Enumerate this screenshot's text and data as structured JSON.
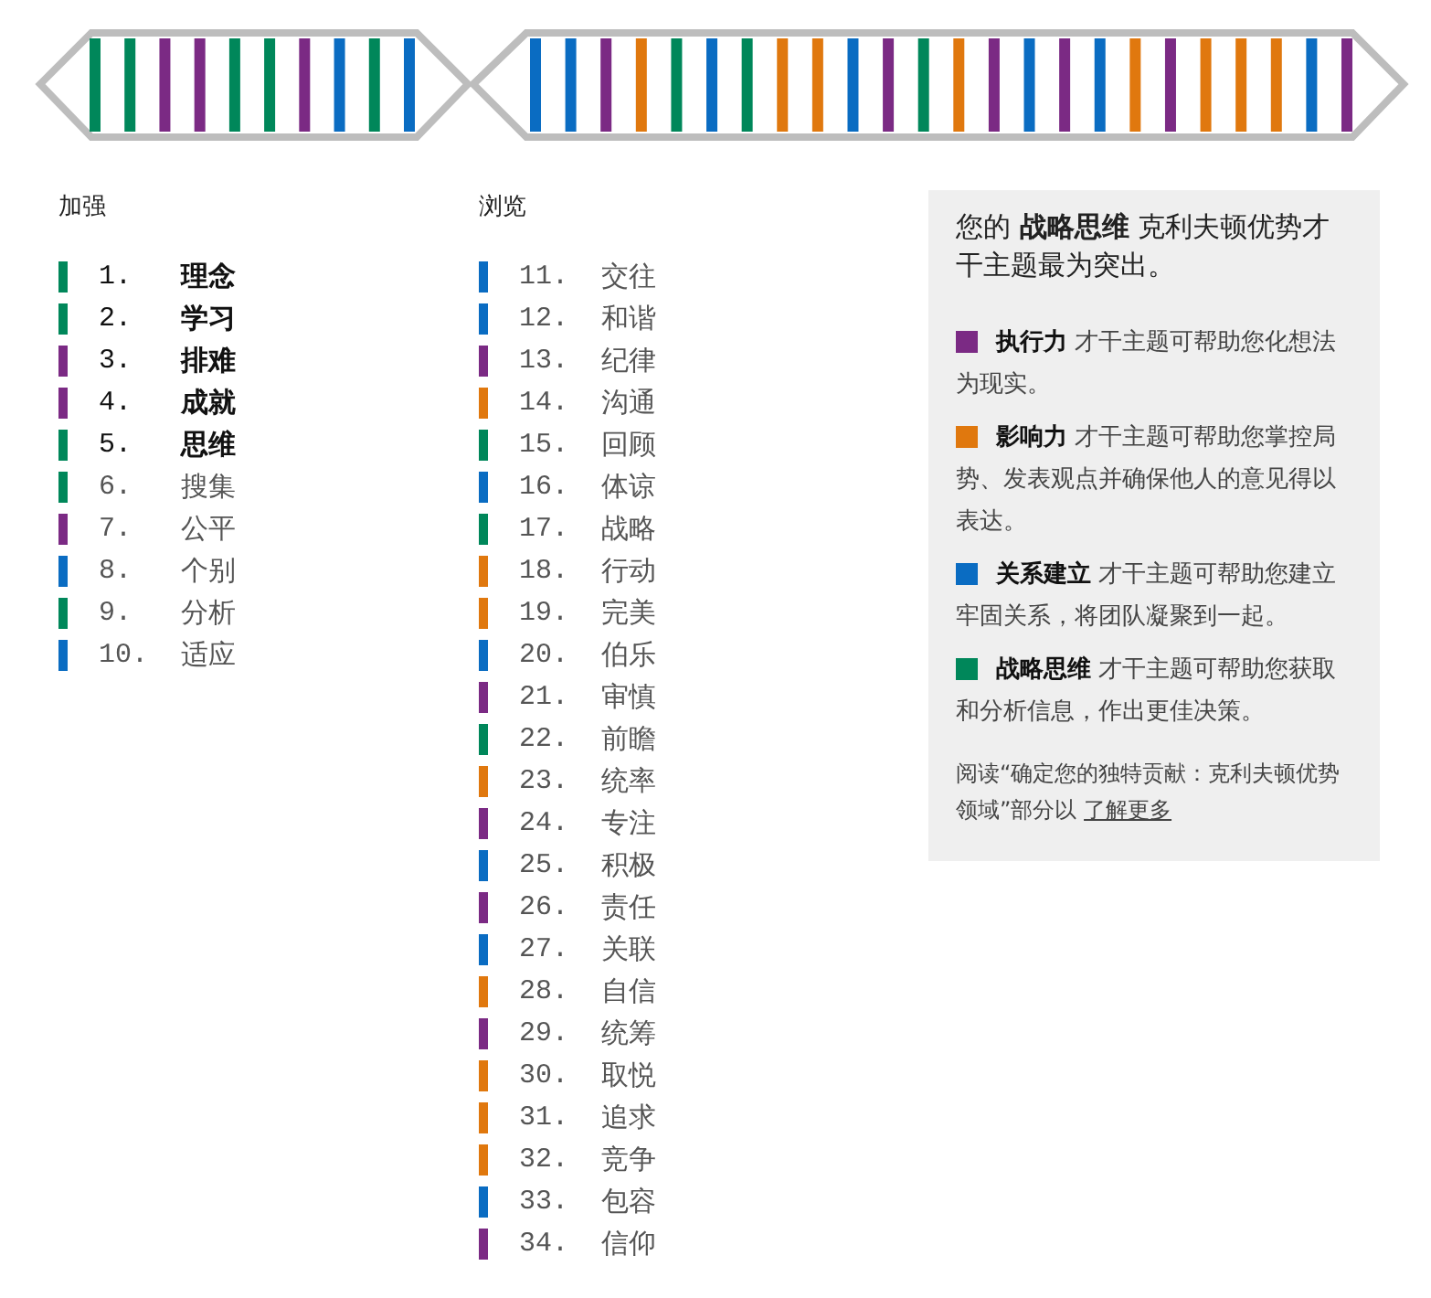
{
  "columns": [
    {
      "heading": "加强",
      "items": [
        {
          "number": "1.",
          "name": "理念",
          "color": "#00875a",
          "bold": true
        },
        {
          "number": "2.",
          "name": "学习",
          "color": "#00875a",
          "bold": true
        },
        {
          "number": "3.",
          "name": "排难",
          "color": "#7b2a84",
          "bold": true
        },
        {
          "number": "4.",
          "name": "成就",
          "color": "#7b2a84",
          "bold": true
        },
        {
          "number": "5.",
          "name": "思维",
          "color": "#00875a",
          "bold": true
        },
        {
          "number": "6.",
          "name": "搜集",
          "color": "#00875a",
          "bold": false
        },
        {
          "number": "7.",
          "name": "公平",
          "color": "#7b2a84",
          "bold": false
        },
        {
          "number": "8.",
          "name": "个别",
          "color": "#0a6cc2",
          "bold": false
        },
        {
          "number": "9.",
          "name": "分析",
          "color": "#00875a",
          "bold": false
        },
        {
          "number": "10.",
          "name": "适应",
          "color": "#0a6cc2",
          "bold": false
        }
      ]
    },
    {
      "heading": "浏览",
      "items": [
        {
          "number": "11.",
          "name": "交往",
          "color": "#0a6cc2",
          "bold": false
        },
        {
          "number": "12.",
          "name": "和谐",
          "color": "#0a6cc2",
          "bold": false
        },
        {
          "number": "13.",
          "name": "纪律",
          "color": "#7b2a84",
          "bold": false
        },
        {
          "number": "14.",
          "name": "沟通",
          "color": "#e0780e",
          "bold": false
        },
        {
          "number": "15.",
          "name": "回顾",
          "color": "#00875a",
          "bold": false
        },
        {
          "number": "16.",
          "name": "体谅",
          "color": "#0a6cc2",
          "bold": false
        },
        {
          "number": "17.",
          "name": "战略",
          "color": "#00875a",
          "bold": false
        },
        {
          "number": "18.",
          "name": "行动",
          "color": "#e0780e",
          "bold": false
        },
        {
          "number": "19.",
          "name": "完美",
          "color": "#e0780e",
          "bold": false
        },
        {
          "number": "20.",
          "name": "伯乐",
          "color": "#0a6cc2",
          "bold": false
        },
        {
          "number": "21.",
          "name": "审慎",
          "color": "#7b2a84",
          "bold": false
        },
        {
          "number": "22.",
          "name": "前瞻",
          "color": "#00875a",
          "bold": false
        },
        {
          "number": "23.",
          "name": "统率",
          "color": "#e0780e",
          "bold": false
        },
        {
          "number": "24.",
          "name": "专注",
          "color": "#7b2a84",
          "bold": false
        },
        {
          "number": "25.",
          "name": "积极",
          "color": "#0a6cc2",
          "bold": false
        },
        {
          "number": "26.",
          "name": "责任",
          "color": "#7b2a84",
          "bold": false
        },
        {
          "number": "27.",
          "name": "关联",
          "color": "#0a6cc2",
          "bold": false
        },
        {
          "number": "28.",
          "name": "自信",
          "color": "#e0780e",
          "bold": false
        },
        {
          "number": "29.",
          "name": "统筹",
          "color": "#7b2a84",
          "bold": false
        },
        {
          "number": "30.",
          "name": "取悦",
          "color": "#e0780e",
          "bold": false
        },
        {
          "number": "31.",
          "name": "追求",
          "color": "#e0780e",
          "bold": false
        },
        {
          "number": "32.",
          "name": "竞争",
          "color": "#e0780e",
          "bold": false
        },
        {
          "number": "33.",
          "name": "包容",
          "color": "#0a6cc2",
          "bold": false
        },
        {
          "number": "34.",
          "name": "信仰",
          "color": "#7b2a84",
          "bold": false
        }
      ]
    }
  ],
  "legend": {
    "intro": "您的 **战略思维** 克利夫顿优势才干主题最为突出。",
    "entries": [
      {
        "color": "#7b2a84",
        "text": "**执行力** 才干主题可帮助您化想法为现实。"
      },
      {
        "color": "#e0780e",
        "text": "**影响力** 才干主题可帮助您掌控局势、发表观点并确保他人的意见得以表达。"
      },
      {
        "color": "#0a6cc2",
        "text": "**关系建立** 才干主题可帮助您建立牢固关系，将团队凝聚到一起。"
      },
      {
        "color": "#00875a",
        "text": "**战略思维** 才干主题可帮助您获取和分析信息，作出更佳决策。"
      }
    ],
    "footer": "阅读“确定您的独特贡献：克利夫顿优势领域”部分以",
    "link": "了解更多"
  }
}
